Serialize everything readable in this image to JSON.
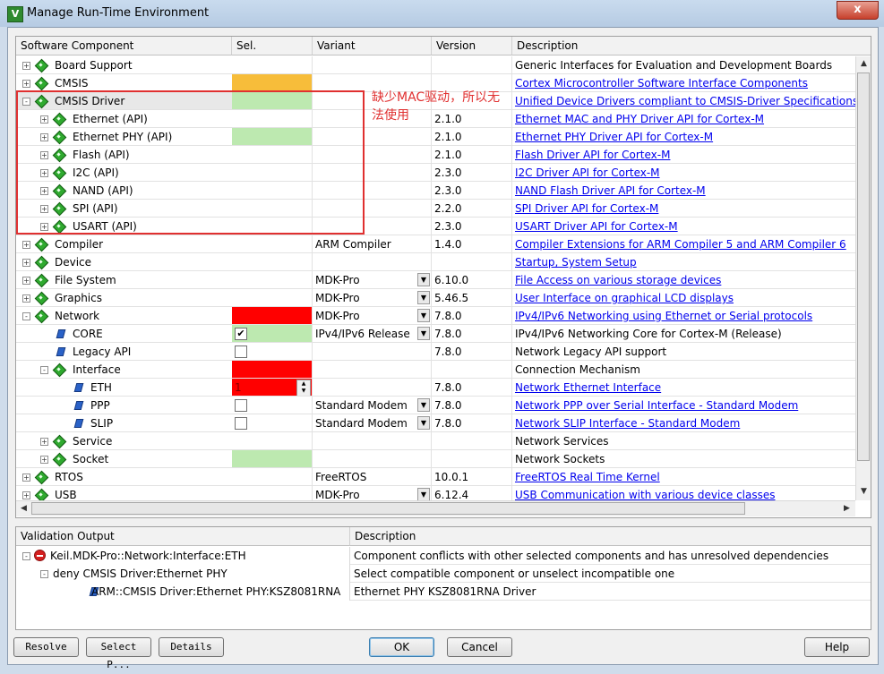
{
  "window": {
    "title": "Manage Run-Time Environment",
    "app_icon": "V",
    "close": "x"
  },
  "columns": [
    "Software Component",
    "Sel.",
    "Variant",
    "Version",
    "Description"
  ],
  "rows": [
    {
      "name": "Board Support",
      "indent": 0,
      "exp": "+",
      "icon": "gem",
      "sel": "",
      "variant": "",
      "dd": false,
      "version": "",
      "desc": "Generic Interfaces for Evaluation and Development Boards",
      "link": false
    },
    {
      "name": "CMSIS",
      "indent": 0,
      "exp": "+",
      "icon": "gem",
      "sel": "#f7bd3a",
      "variant": "",
      "dd": false,
      "version": "",
      "desc": "Cortex Microcontroller Software Interface Components",
      "link": true
    },
    {
      "name": "CMSIS Driver",
      "indent": 0,
      "exp": "-",
      "icon": "gem",
      "sel": "#bde9b0",
      "variant": "",
      "dd": false,
      "version": "",
      "desc": "Unified Device Drivers compliant to CMSIS-Driver Specifications",
      "link": true,
      "selected": true
    },
    {
      "name": "Ethernet (API)",
      "indent": 1,
      "exp": "+",
      "icon": "gem",
      "sel": "",
      "variant": "",
      "dd": false,
      "version": "2.1.0",
      "desc": "Ethernet MAC and PHY Driver API for Cortex-M",
      "link": true
    },
    {
      "name": "Ethernet PHY (API)",
      "indent": 1,
      "exp": "+",
      "icon": "gem",
      "sel": "#bde9b0",
      "variant": "",
      "dd": false,
      "version": "2.1.0",
      "desc": "Ethernet PHY Driver API for Cortex-M",
      "link": true
    },
    {
      "name": "Flash (API)",
      "indent": 1,
      "exp": "+",
      "icon": "gem",
      "sel": "",
      "variant": "",
      "dd": false,
      "version": "2.1.0",
      "desc": "Flash Driver API for Cortex-M",
      "link": true
    },
    {
      "name": "I2C (API)",
      "indent": 1,
      "exp": "+",
      "icon": "gem",
      "sel": "",
      "variant": "",
      "dd": false,
      "version": "2.3.0",
      "desc": "I2C Driver API for Cortex-M",
      "link": true
    },
    {
      "name": "NAND (API)",
      "indent": 1,
      "exp": "+",
      "icon": "gem",
      "sel": "",
      "variant": "",
      "dd": false,
      "version": "2.3.0",
      "desc": "NAND Flash Driver API for Cortex-M",
      "link": true
    },
    {
      "name": "SPI (API)",
      "indent": 1,
      "exp": "+",
      "icon": "gem",
      "sel": "",
      "variant": "",
      "dd": false,
      "version": "2.2.0",
      "desc": "SPI Driver API for Cortex-M",
      "link": true
    },
    {
      "name": "USART (API)",
      "indent": 1,
      "exp": "+",
      "icon": "gem",
      "sel": "",
      "variant": "",
      "dd": false,
      "version": "2.3.0",
      "desc": "USART Driver API for Cortex-M",
      "link": true
    },
    {
      "name": "Compiler",
      "indent": 0,
      "exp": "+",
      "icon": "gem",
      "sel": "",
      "variant": "ARM Compiler",
      "dd": false,
      "version": "1.4.0",
      "desc": "Compiler Extensions for ARM Compiler 5 and ARM Compiler 6",
      "link": true
    },
    {
      "name": "Device",
      "indent": 0,
      "exp": "+",
      "icon": "gem",
      "sel": "",
      "variant": "",
      "dd": false,
      "version": "",
      "desc": "Startup, System Setup",
      "link": true
    },
    {
      "name": "File System",
      "indent": 0,
      "exp": "+",
      "icon": "gem",
      "sel": "",
      "variant": "MDK-Pro",
      "dd": true,
      "version": "6.10.0",
      "desc": "File Access on various storage devices",
      "link": true
    },
    {
      "name": "Graphics",
      "indent": 0,
      "exp": "+",
      "icon": "gem",
      "sel": "",
      "variant": "MDK-Pro",
      "dd": true,
      "version": "5.46.5",
      "desc": "User Interface on graphical LCD displays",
      "link": true
    },
    {
      "name": "Network",
      "indent": 0,
      "exp": "-",
      "icon": "gem",
      "sel": "#ff0000",
      "variant": "MDK-Pro",
      "dd": true,
      "version": "7.8.0",
      "desc": "IPv4/IPv6 Networking using Ethernet or Serial protocols",
      "link": true
    },
    {
      "name": "CORE",
      "indent": 1,
      "exp": "",
      "icon": "leaf",
      "sel": "#bde9b0",
      "check": true,
      "checked": true,
      "variant": "IPv4/IPv6 Release",
      "dd": true,
      "version": "7.8.0",
      "desc": "IPv4/IPv6 Networking Core for Cortex-M (Release)",
      "link": false
    },
    {
      "name": "Legacy API",
      "indent": 1,
      "exp": "",
      "icon": "leaf",
      "sel": "",
      "check": true,
      "checked": false,
      "variant": "",
      "dd": false,
      "version": "7.8.0",
      "desc": "Network Legacy API support",
      "link": false
    },
    {
      "name": "Interface",
      "indent": 1,
      "exp": "-",
      "icon": "gem",
      "sel": "#ff0000",
      "variant": "",
      "dd": false,
      "version": "",
      "desc": "Connection Mechanism",
      "link": false
    },
    {
      "name": "ETH",
      "indent": 2,
      "exp": "",
      "icon": "leaf2",
      "sel": "#ff0000",
      "spin": "1",
      "variant": "",
      "dd": false,
      "version": "7.8.0",
      "desc": "Network Ethernet Interface",
      "link": true
    },
    {
      "name": "PPP",
      "indent": 2,
      "exp": "",
      "icon": "leaf",
      "sel": "",
      "check": true,
      "checked": false,
      "variant": "Standard Modem",
      "dd": true,
      "version": "7.8.0",
      "desc": "Network PPP over Serial Interface - Standard Modem",
      "link": true
    },
    {
      "name": "SLIP",
      "indent": 2,
      "exp": "",
      "icon": "leaf",
      "sel": "",
      "check": true,
      "checked": false,
      "variant": "Standard Modem",
      "dd": true,
      "version": "7.8.0",
      "desc": "Network SLIP Interface - Standard Modem",
      "link": true
    },
    {
      "name": "Service",
      "indent": 1,
      "exp": "+",
      "icon": "gem",
      "sel": "",
      "variant": "",
      "dd": false,
      "version": "",
      "desc": "Network Services",
      "link": false
    },
    {
      "name": "Socket",
      "indent": 1,
      "exp": "+",
      "icon": "gem",
      "sel": "#bde9b0",
      "variant": "",
      "dd": false,
      "version": "",
      "desc": "Network Sockets",
      "link": false
    },
    {
      "name": "RTOS",
      "indent": 0,
      "exp": "+",
      "icon": "gem",
      "sel": "",
      "variant": "FreeRTOS",
      "dd": false,
      "version": "10.0.1",
      "desc": "FreeRTOS Real Time Kernel",
      "link": true
    },
    {
      "name": "USB",
      "indent": 0,
      "exp": "+",
      "icon": "gem",
      "sel": "",
      "variant": "MDK-Pro",
      "dd": true,
      "version": "6.12.4",
      "desc": "USB Communication with various device classes",
      "link": true
    }
  ],
  "annotation": "缺少MAC驱动，所以无法使用",
  "validation": {
    "columns": [
      "Validation Output",
      "Description"
    ],
    "rows": [
      {
        "text": "Keil.MDK-Pro::Network:Interface:ETH",
        "desc": "Component conflicts with other selected components and has unresolved dependencies",
        "icon": "error",
        "level": 0
      },
      {
        "text": "deny CMSIS Driver:Ethernet PHY",
        "desc": "Select compatible component or unselect incompatible one",
        "icon": "",
        "level": 1
      },
      {
        "text": "ARM::CMSIS Driver:Ethernet PHY:KSZ8081RNA",
        "desc": "Ethernet PHY KSZ8081RNA Driver",
        "icon": "leaf",
        "level": 2
      }
    ]
  },
  "buttons": {
    "resolve": "Resolve",
    "select_packs": "Select P...",
    "details": "Details",
    "ok": "OK",
    "cancel": "Cancel",
    "help": "Help"
  }
}
